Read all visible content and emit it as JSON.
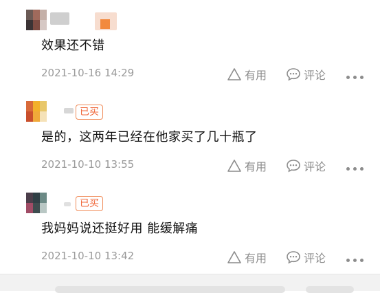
{
  "reviews": [
    {
      "badge": "",
      "text": "效果还不错",
      "date": "2021-10-16 14:29",
      "helpful_label": "有用",
      "comment_label": "评论"
    },
    {
      "badge": "已买",
      "text": "是的，这两年已经在他家买了几十瓶了",
      "date": "2021-10-10 13:55",
      "helpful_label": "有用",
      "comment_label": "评论"
    },
    {
      "badge": "已买",
      "text": "我妈妈说还挺好用 能缓解痛",
      "date": "2021-10-10 13:42",
      "helpful_label": "有用",
      "comment_label": "评论"
    }
  ],
  "colors": {
    "badge_border": "#f08a57",
    "badge_text": "#f0673a",
    "muted_text": "#9a9a9a",
    "icon_gray": "#8c8c8c"
  },
  "icons": [
    "helpful-triangle-icon",
    "comment-bubble-icon",
    "more-dots-icon"
  ]
}
